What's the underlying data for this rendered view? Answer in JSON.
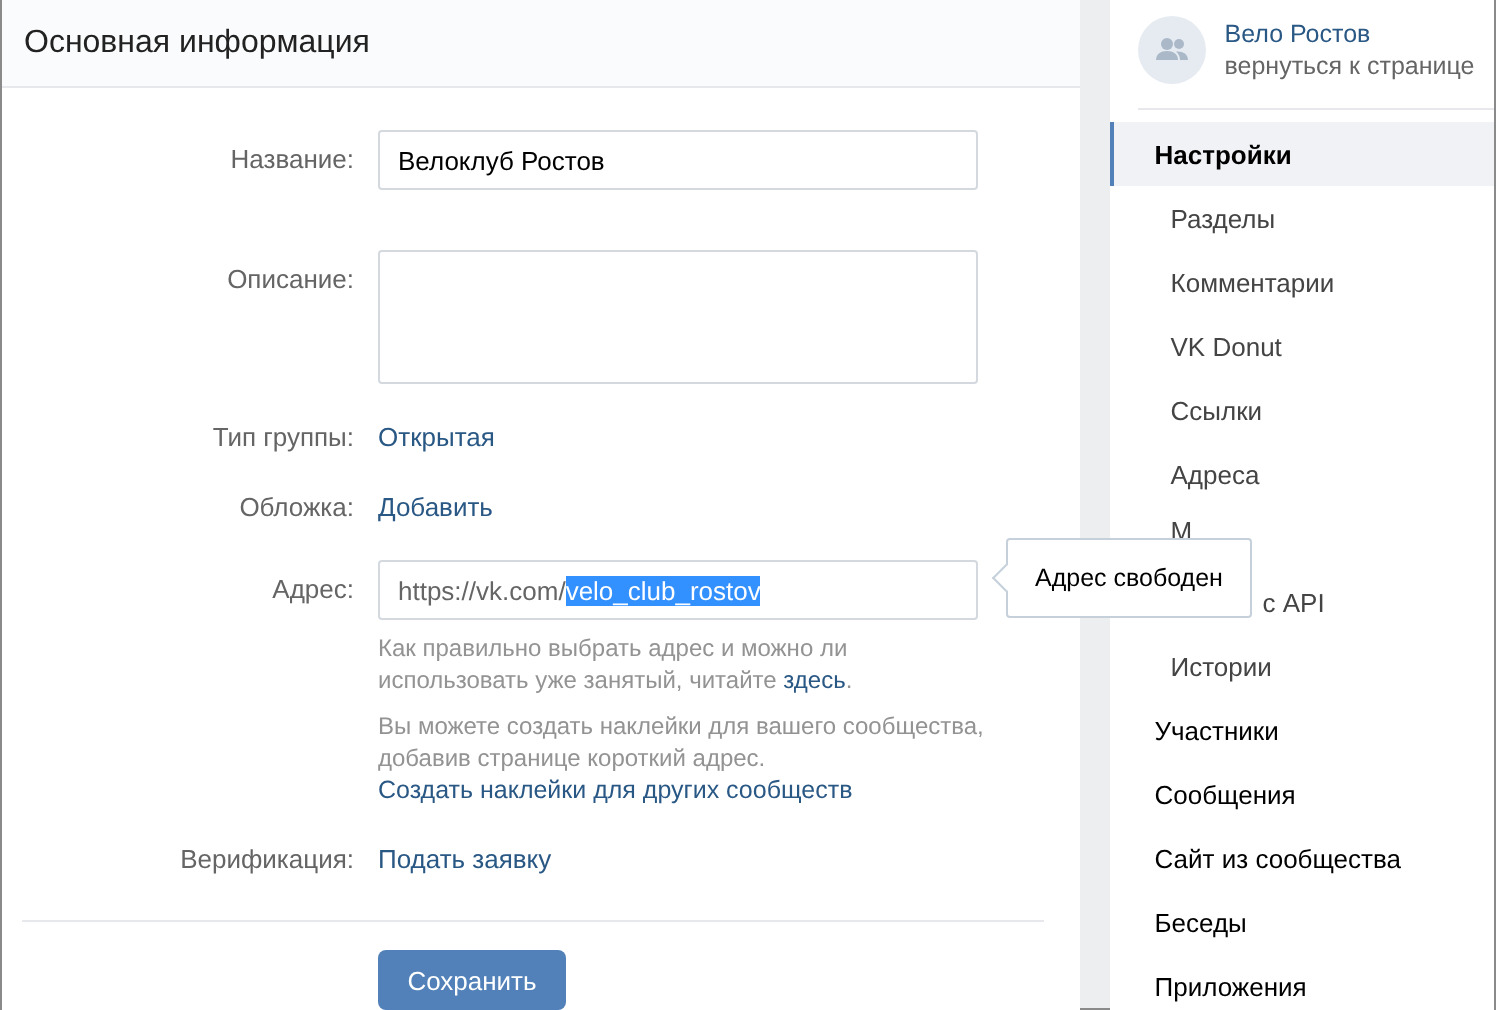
{
  "main": {
    "title": "Основная информация",
    "fields": [
      {
        "kind": "input",
        "label": "Название:",
        "value": "Велоклуб Ростов"
      },
      {
        "kind": "textarea",
        "label": "Описание:"
      },
      {
        "kind": "link",
        "label": "Тип группы:",
        "value": "Открытая"
      },
      {
        "kind": "link",
        "label": "Обложка:",
        "value": "Добавить"
      },
      {
        "kind": "address",
        "label": "Адрес:",
        "prefix": "https://vk.com/",
        "value": "velo_club_rostov",
        "selected": true,
        "tooltip": "Адрес свободен",
        "help": [
          {
            "before": "Как правильно выбрать адрес и можно ли использовать уже занятый, читайте ",
            "link": "здесь",
            "after": "."
          },
          {
            "before": "Вы можете создать наклейки для вашего сообщества, добавив странице короткий адрес."
          }
        ],
        "extra_link": "Создать наклейки для других сообществ"
      },
      {
        "kind": "link",
        "label": "Верификация:",
        "value": "Подать заявку"
      }
    ],
    "save_button": "Сохранить"
  },
  "sidebar": {
    "group_name": "Вело Ростов",
    "back_link": "вернуться к странице",
    "items": [
      {
        "label": "Настройки",
        "selected": true,
        "children": [
          {
            "label": "Разделы",
            "selected": false
          },
          {
            "label": "Комментарии",
            "selected": false
          },
          {
            "label": "VK Donut",
            "selected": false
          },
          {
            "label": "Ссылки",
            "selected": false
          },
          {
            "label": "Адреса",
            "selected": false
          },
          {
            "label": "М",
            "selected": false
          },
          {
            "label": "с API",
            "selected": false
          },
          {
            "label": "Истории",
            "selected": false
          }
        ]
      },
      {
        "label": "Участники",
        "selected": false
      },
      {
        "label": "Сообщения",
        "selected": false
      },
      {
        "label": "Сайт из сообщества",
        "selected": false
      },
      {
        "label": "Беседы",
        "selected": false
      },
      {
        "label": "Приложения",
        "selected": false
      }
    ]
  }
}
